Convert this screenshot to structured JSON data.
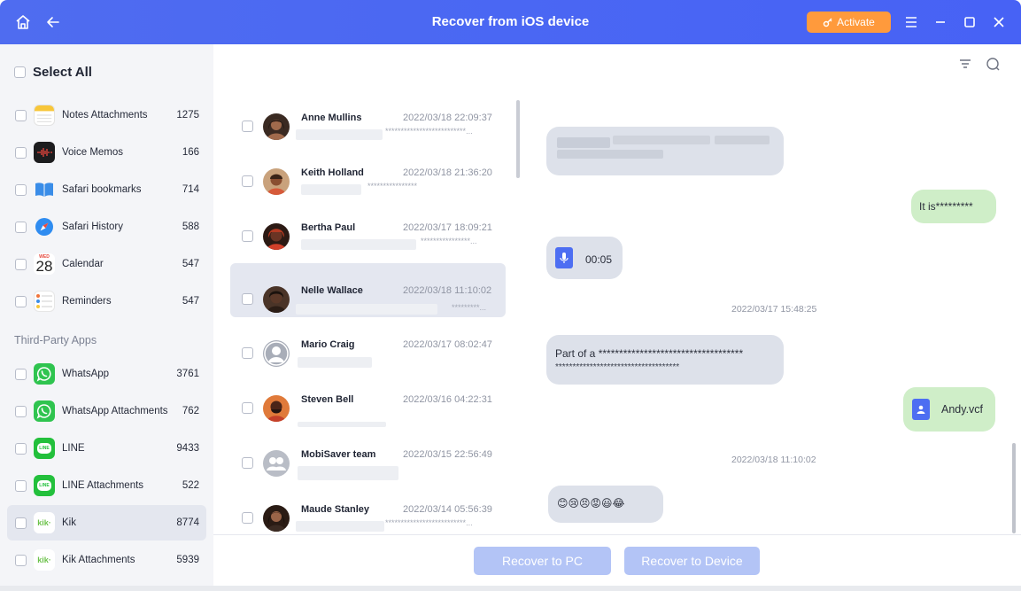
{
  "titlebar": {
    "title": "Recover from iOS device",
    "activate_label": "Activate"
  },
  "sidebar": {
    "select_all": "Select All",
    "section_third_party": "Third-Party Apps",
    "items": [
      {
        "label": "Notes Attachments",
        "count": "1275",
        "icon": "notes-icon"
      },
      {
        "label": "Voice Memos",
        "count": "166",
        "icon": "voice-memos-icon"
      },
      {
        "label": "Safari bookmarks",
        "count": "714",
        "icon": "book-icon"
      },
      {
        "label": "Safari History",
        "count": "588",
        "icon": "compass-icon"
      },
      {
        "label": "Calendar",
        "count": "547",
        "icon": "calendar-icon",
        "icon_day": "WED",
        "icon_date": "28"
      },
      {
        "label": "Reminders",
        "count": "547",
        "icon": "reminders-icon"
      },
      {
        "label": "WhatsApp",
        "count": "3761",
        "icon": "whatsapp-icon"
      },
      {
        "label": "WhatsApp Attachments",
        "count": "762",
        "icon": "whatsapp-icon"
      },
      {
        "label": "LINE",
        "count": "9433",
        "icon": "line-icon",
        "icon_text": "LINE"
      },
      {
        "label": "LINE Attachments",
        "count": "522",
        "icon": "line-icon",
        "icon_text": "LINE"
      },
      {
        "label": "Kik",
        "count": "8774",
        "icon": "kik-icon",
        "icon_text": "kik·",
        "selected": true
      },
      {
        "label": "Kik Attachments",
        "count": "5939",
        "icon": "kik-icon",
        "icon_text": "kik·"
      }
    ]
  },
  "conversations": [
    {
      "name": "Anne Mullins",
      "time": "2022/03/18 22:09:37",
      "stars": "**************************...",
      "avatar_color": "#6b4a3a"
    },
    {
      "name": "Keith Holland",
      "time": "2022/03/18 21:36:20",
      "stars": "****************",
      "avatar_color": "#8a5a3c"
    },
    {
      "name": "Bertha Paul",
      "time": "2022/03/17 18:09:21",
      "stars": "****************...",
      "avatar_color": "#9b3a2a"
    },
    {
      "name": "Nelle Wallace",
      "time": "2022/03/18 11:10:02",
      "stars": "*********...",
      "avatar_color": "#5b3b2b",
      "selected": true
    },
    {
      "name": "Mario Craig",
      "time": "2022/03/17 08:02:47",
      "stars": "",
      "avatar_color": "#9aa0ab",
      "placeholder": true
    },
    {
      "name": "Steven Bell",
      "time": "2022/03/16 04:22:31",
      "stars": "",
      "avatar_color": "#c0502a"
    },
    {
      "name": "MobiSaver team",
      "time": "2022/03/15 22:56:49",
      "stars": "",
      "avatar_color": "#b9bdc6",
      "group": true
    },
    {
      "name": "Maude Stanley",
      "time": "2022/03/14 05:56:39",
      "stars": "**************************...",
      "avatar_color": "#5c3a2c"
    }
  ],
  "chat": {
    "msg_out_1": "It is*********",
    "voice_duration": "00:05",
    "timestamp_1": "2022/03/17 15:48:25",
    "msg_in_2_line1": "Part of a ***********************************",
    "msg_in_2_line2": "************************************",
    "file_name": "Andy.vcf",
    "timestamp_2": "2022/03/18 11:10:02",
    "emoji_row": "😊😢😣😡😃😂"
  },
  "actions": {
    "recover_pc": "Recover to PC",
    "recover_device": "Recover to Device"
  },
  "colors": {
    "titlebar": "#4a67f3",
    "activate": "#ff9a3c",
    "incoming_bubble": "#dde1ea",
    "outgoing_bubble": "#cfeec8",
    "button_disabled": "#b3c4f6"
  }
}
